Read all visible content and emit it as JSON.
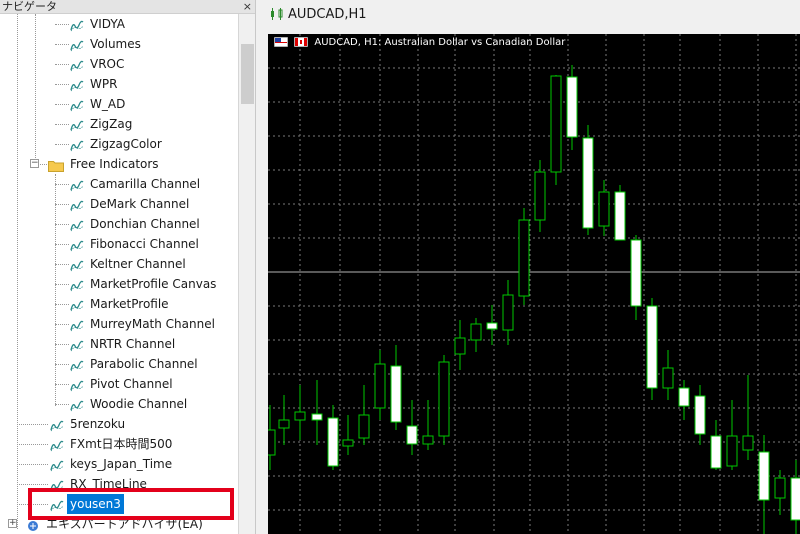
{
  "navigator": {
    "title": "ナビゲータ",
    "close_glyph": "×",
    "items_top": [
      "VIDYA",
      "Volumes",
      "VROC",
      "WPR",
      "W_AD",
      "ZigZag",
      "ZigzagColor"
    ],
    "folder": "Free Indicators",
    "folder_items": [
      "Camarilla Channel",
      "DeMark Channel",
      "Donchian Channel",
      "Fibonacci Channel",
      "Keltner Channel",
      "MarketProfile Canvas",
      "MarketProfile",
      "MurreyMath Channel",
      "NRTR Channel",
      "Parabolic Channel",
      "Pivot Channel",
      "Woodie Channel"
    ],
    "root_items": [
      "5renzoku",
      "FXmt日本時間500",
      "keys_Japan_Time",
      "RX_TimeLine"
    ],
    "selected_item": "yousen3",
    "bottom_item": "エキスパートアドバイザ(EA)"
  },
  "chart": {
    "tab_title": "AUDCAD,H1",
    "header_text": "AUDCAD, H1:  Australian Dollar vs Canadian Dollar",
    "colors": {
      "background": "#000000",
      "bull_body": "#ffffff",
      "wick": "#00c800",
      "grid": "#7a7a7a",
      "hline": "#b4b4b4"
    }
  }
}
